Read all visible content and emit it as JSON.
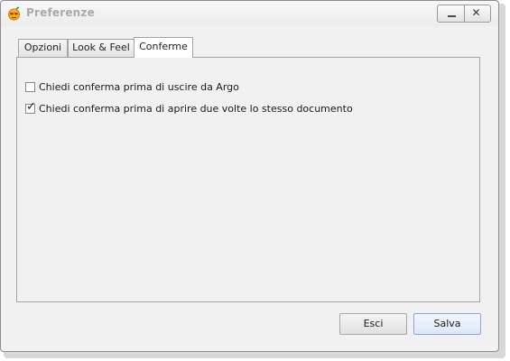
{
  "window": {
    "title": "Preferenze",
    "minimize_icon": "minimize-icon",
    "close_icon": "close-icon",
    "close_glyph": "✕"
  },
  "tabs": [
    {
      "label": "Opzioni",
      "selected": false
    },
    {
      "label": "Look & Feel",
      "selected": false
    },
    {
      "label": "Conferme",
      "selected": true
    }
  ],
  "confirm_options": [
    {
      "label": "Chiedi conferma prima di uscire da Argo",
      "checked": false
    },
    {
      "label": "Chiedi conferma prima di aprire due volte lo stesso documento",
      "checked": true
    }
  ],
  "check_glyph": "✓",
  "buttons": {
    "cancel_label": "Esci",
    "save_label": "Salva"
  },
  "colors": {
    "title_text": "#a9a9a9",
    "save_button_accent": "#dde7fb"
  }
}
